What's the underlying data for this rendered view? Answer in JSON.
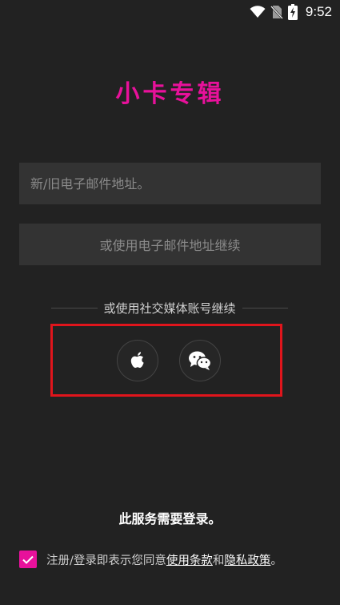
{
  "status_bar": {
    "time": "9:52"
  },
  "app": {
    "title": "小卡专辑",
    "brand_color": "#e8119b"
  },
  "email": {
    "placeholder": "新/旧电子邮件地址。",
    "value": ""
  },
  "continue_button": {
    "label": "或使用电子邮件地址继续"
  },
  "social": {
    "divider_text": "或使用社交媒体账号继续",
    "highlight_color": "#e0151c",
    "providers": [
      {
        "name": "apple-icon"
      },
      {
        "name": "wechat-icon"
      }
    ]
  },
  "login_notice": "此服务需要登录。",
  "agreement": {
    "checked": true,
    "prefix": "注册/登录即表示您同意",
    "terms_link": "使用条款",
    "and": "和",
    "privacy_link": "隐私政策",
    "suffix": "。"
  }
}
